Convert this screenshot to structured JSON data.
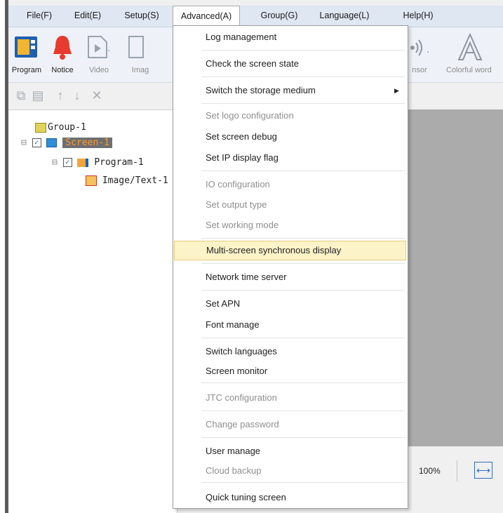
{
  "menubar": {
    "items": [
      "File(F)",
      "Edit(E)",
      "Setup(S)",
      "Advanced(A)",
      "Group(G)",
      "Language(L)",
      "Help(H)"
    ],
    "active_index": 3
  },
  "toolbar": {
    "program": "Program",
    "notice": "Notice",
    "video": "Video",
    "image_partial": "Imag",
    "sensor_partial": "nsor",
    "colorful_word_partial": "Colorful word"
  },
  "tree": {
    "root_label_overlap": "Group-1",
    "screen": "Screen-1",
    "program": "Program-1",
    "image_text": "Image/Text-1"
  },
  "status": {
    "zoom": "100%"
  },
  "menu": {
    "items": [
      {
        "label": "Log management",
        "disabled": false
      },
      {
        "label": "Check the screen state",
        "disabled": false
      },
      {
        "label": "Switch the storage medium",
        "disabled": false,
        "submenu": true
      },
      {
        "label": "Set logo configuration",
        "disabled": true
      },
      {
        "label": "Set screen debug",
        "disabled": false
      },
      {
        "label": "Set IP display flag",
        "disabled": false
      },
      {
        "label": "IO configuration",
        "disabled": true
      },
      {
        "label": "Set output type",
        "disabled": true
      },
      {
        "label": "Set working mode",
        "disabled": true
      },
      {
        "label": "Multi-screen synchronous display",
        "disabled": false,
        "highlighted": true
      },
      {
        "label": "Network time server",
        "disabled": false
      },
      {
        "label": "Set APN",
        "disabled": false
      },
      {
        "label": "Font manage",
        "disabled": false
      },
      {
        "label": "Switch languages",
        "disabled": false
      },
      {
        "label": "Screen monitor",
        "disabled": false
      },
      {
        "label": "JTC configuration",
        "disabled": true
      },
      {
        "label": "Change password",
        "disabled": true
      },
      {
        "label": "User manage",
        "disabled": false
      },
      {
        "label": "Cloud backup",
        "disabled": true
      },
      {
        "label": "Quick tuning screen",
        "disabled": false
      }
    ]
  },
  "colors": {
    "menubar_bg": "#dfe7f3",
    "highlight_bg": "#fdf3c8",
    "selected_node_bg": "#6f6f6f",
    "selected_node_text": "#ff9a2e",
    "canvas_bg": "#ababab"
  }
}
